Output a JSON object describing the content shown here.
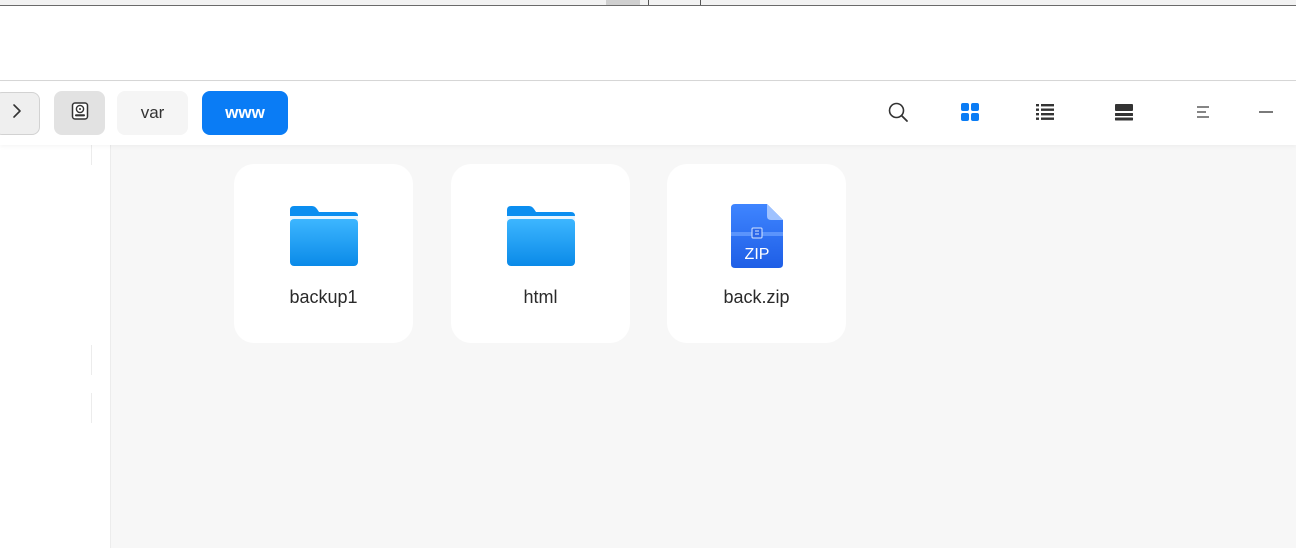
{
  "toolbar": {
    "forward_icon": "chevron-right-icon",
    "drive_icon": "hard-drive-icon",
    "breadcrumbs": [
      {
        "label": "var",
        "active": false
      },
      {
        "label": "www",
        "active": true
      }
    ],
    "actions": [
      "search-icon",
      "grid-view-icon",
      "list-view-icon",
      "detail-view-icon",
      "menu-icon",
      "minimize-icon"
    ]
  },
  "files": [
    {
      "name": "backup1",
      "type": "folder",
      "icon": "folder-icon"
    },
    {
      "name": "html",
      "type": "folder",
      "icon": "folder-icon"
    },
    {
      "name": "back.zip",
      "type": "zip",
      "icon": "zip-file-icon",
      "badge": "ZIP"
    }
  ],
  "colors": {
    "accent": "#0a7cf5",
    "folder": "#1e9bf0",
    "zip": "#2f6ff0",
    "content_bg": "#f7f7f7"
  }
}
